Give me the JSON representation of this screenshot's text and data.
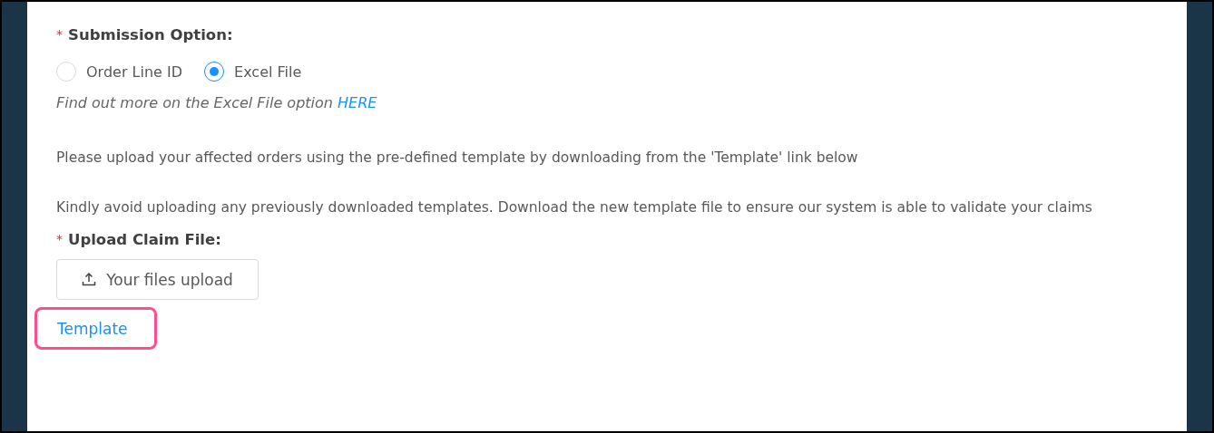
{
  "submission_option": {
    "required_mark": "*",
    "label": "Submission Option:",
    "options": [
      {
        "label": "Order Line ID",
        "selected": false
      },
      {
        "label": "Excel File",
        "selected": true
      }
    ],
    "help_text": "Find out more on the Excel File option",
    "help_link": "HERE"
  },
  "instructions": [
    "Please upload your affected orders using the pre-defined template by downloading from the 'Template' link below",
    "Kindly avoid uploading any previously downloaded templates. Download the new template file to ensure our system is able to validate your claims"
  ],
  "upload_claim_file": {
    "required_mark": "*",
    "label": "Upload Claim File:",
    "button": "Your files upload"
  },
  "template_link": {
    "label": "Template",
    "highlighted": true
  }
}
